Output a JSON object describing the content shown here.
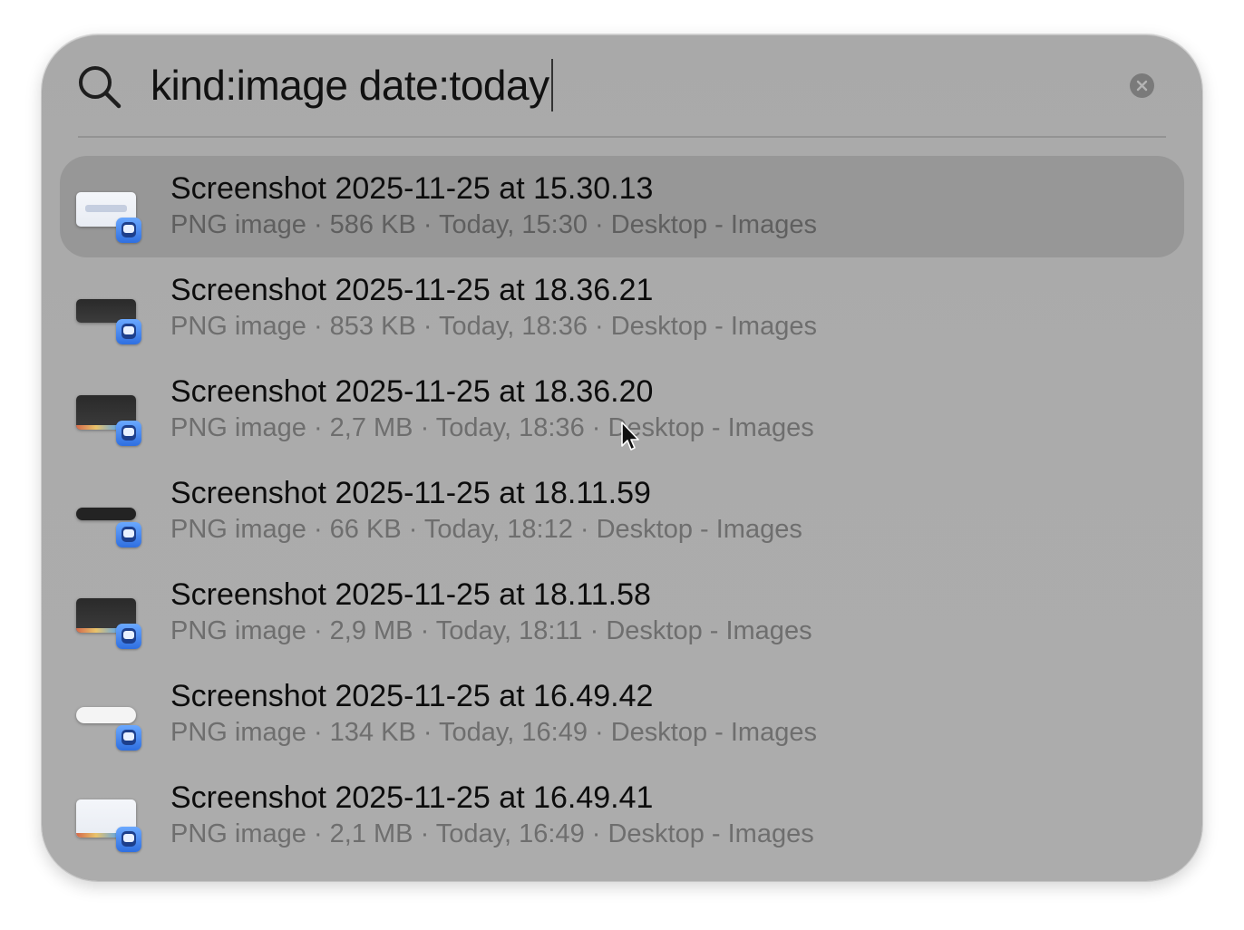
{
  "search": {
    "query": "kind:image date:today",
    "icon": "magnifying-glass",
    "clear_icon": "xmark-circle"
  },
  "results": [
    {
      "title": "Screenshot 2025-11-25 at 15.30.13",
      "subtitle": "PNG image · 586 KB · Today, 15:30 ·  Desktop - Images",
      "selected": true,
      "thumb": "light"
    },
    {
      "title": "Screenshot 2025-11-25 at 18.36.21",
      "subtitle": "PNG image · 853 KB · Today, 18:36 ·  Desktop - Images",
      "selected": false,
      "thumb": "dark-small"
    },
    {
      "title": "Screenshot 2025-11-25 at 18.36.20",
      "subtitle": "PNG image · 2,7 MB · Today, 18:36 ·  Desktop - Images",
      "selected": false,
      "thumb": "dark"
    },
    {
      "title": "Screenshot 2025-11-25 at 18.11.59",
      "subtitle": "PNG image · 66 KB · Today, 18:12 ·  Desktop - Images",
      "selected": false,
      "thumb": "pill"
    },
    {
      "title": "Screenshot 2025-11-25 at 18.11.58",
      "subtitle": "PNG image · 2,9 MB · Today, 18:11 ·  Desktop - Images",
      "selected": false,
      "thumb": "dark"
    },
    {
      "title": "Screenshot 2025-11-25 at 16.49.42",
      "subtitle": "PNG image · 134 KB · Today, 16:49 ·  Desktop - Images",
      "selected": false,
      "thumb": "pill-light"
    },
    {
      "title": "Screenshot 2025-11-25 at 16.49.41",
      "subtitle": "PNG image · 2,1 MB · Today, 16:49 ·  Desktop - Images",
      "selected": false,
      "thumb": "light"
    }
  ],
  "colors": {
    "panel": "#ababab",
    "selected_row": "#979797",
    "title_text": "#0d0d0d",
    "subtitle_text": "#6e6e6e",
    "badge": "#2f6fe0"
  }
}
